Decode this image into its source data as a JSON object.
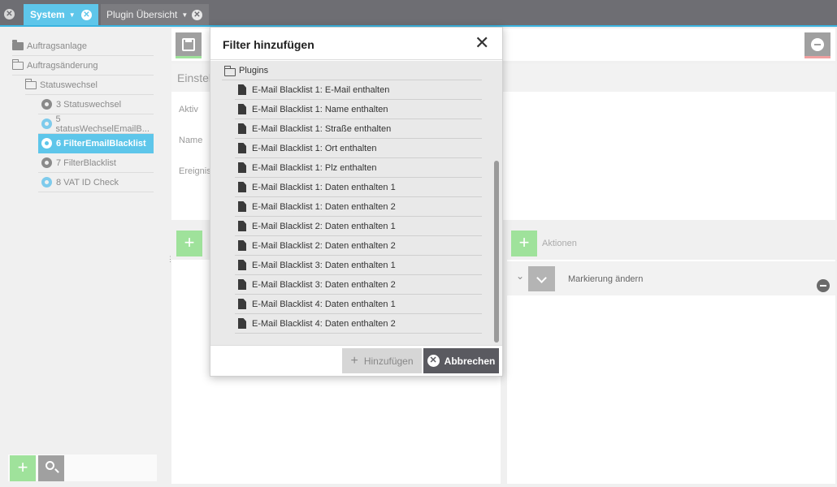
{
  "tabs": [
    {
      "label": "System",
      "active": true
    },
    {
      "label": "Plugin Übersicht",
      "active": false
    }
  ],
  "tree": {
    "items": [
      {
        "label": "Auftragsanlage",
        "icon": "folder-solid-icon"
      },
      {
        "label": "Auftragsänderung",
        "icon": "folder-open-icon"
      },
      {
        "label": "Statuswechsel",
        "icon": "folder-open-icon"
      },
      {
        "label": "3 Statuswechsel",
        "icon": "gear-icon"
      },
      {
        "label": "5 statusWechselEmailB...",
        "icon": "gear-icon"
      },
      {
        "label": "6 FilterEmailBlacklist",
        "icon": "gear-icon",
        "active": true
      },
      {
        "label": "7 FilterBlacklist",
        "icon": "gear-icon"
      },
      {
        "label": "8 VAT ID Check",
        "icon": "gear-icon"
      }
    ]
  },
  "settings": {
    "title": "Einstel",
    "fields": [
      "Aktiv",
      "Name",
      "Ereignis"
    ]
  },
  "actions": {
    "label": "Aktionen",
    "row_label": "Markierung ändern"
  },
  "modal": {
    "title": "Filter hinzufügen",
    "root_label": "Plugins",
    "items": [
      "E-Mail Blacklist 1: E-Mail enthalten",
      "E-Mail Blacklist 1: Name enthalten",
      "E-Mail Blacklist 1: Straße enthalten",
      "E-Mail Blacklist 1: Ort enthalten",
      "E-Mail Blacklist 1: Plz enthalten",
      "E-Mail Blacklist 1: Daten enthalten 1",
      "E-Mail Blacklist 1: Daten enthalten 2",
      "E-Mail Blacklist 2: Daten enthalten 1",
      "E-Mail Blacklist 2: Daten enthalten 2",
      "E-Mail Blacklist 3: Daten enthalten 1",
      "E-Mail Blacklist 3: Daten enthalten 2",
      "E-Mail Blacklist 4: Daten enthalten 1",
      "E-Mail Blacklist 4: Daten enthalten 2"
    ],
    "add_label": "Hinzufügen",
    "cancel_label": "Abbrechen"
  },
  "colors": {
    "accent": "#5ec6ea",
    "add_green": "#9fe29b",
    "dark_button": "#5a5a60"
  }
}
